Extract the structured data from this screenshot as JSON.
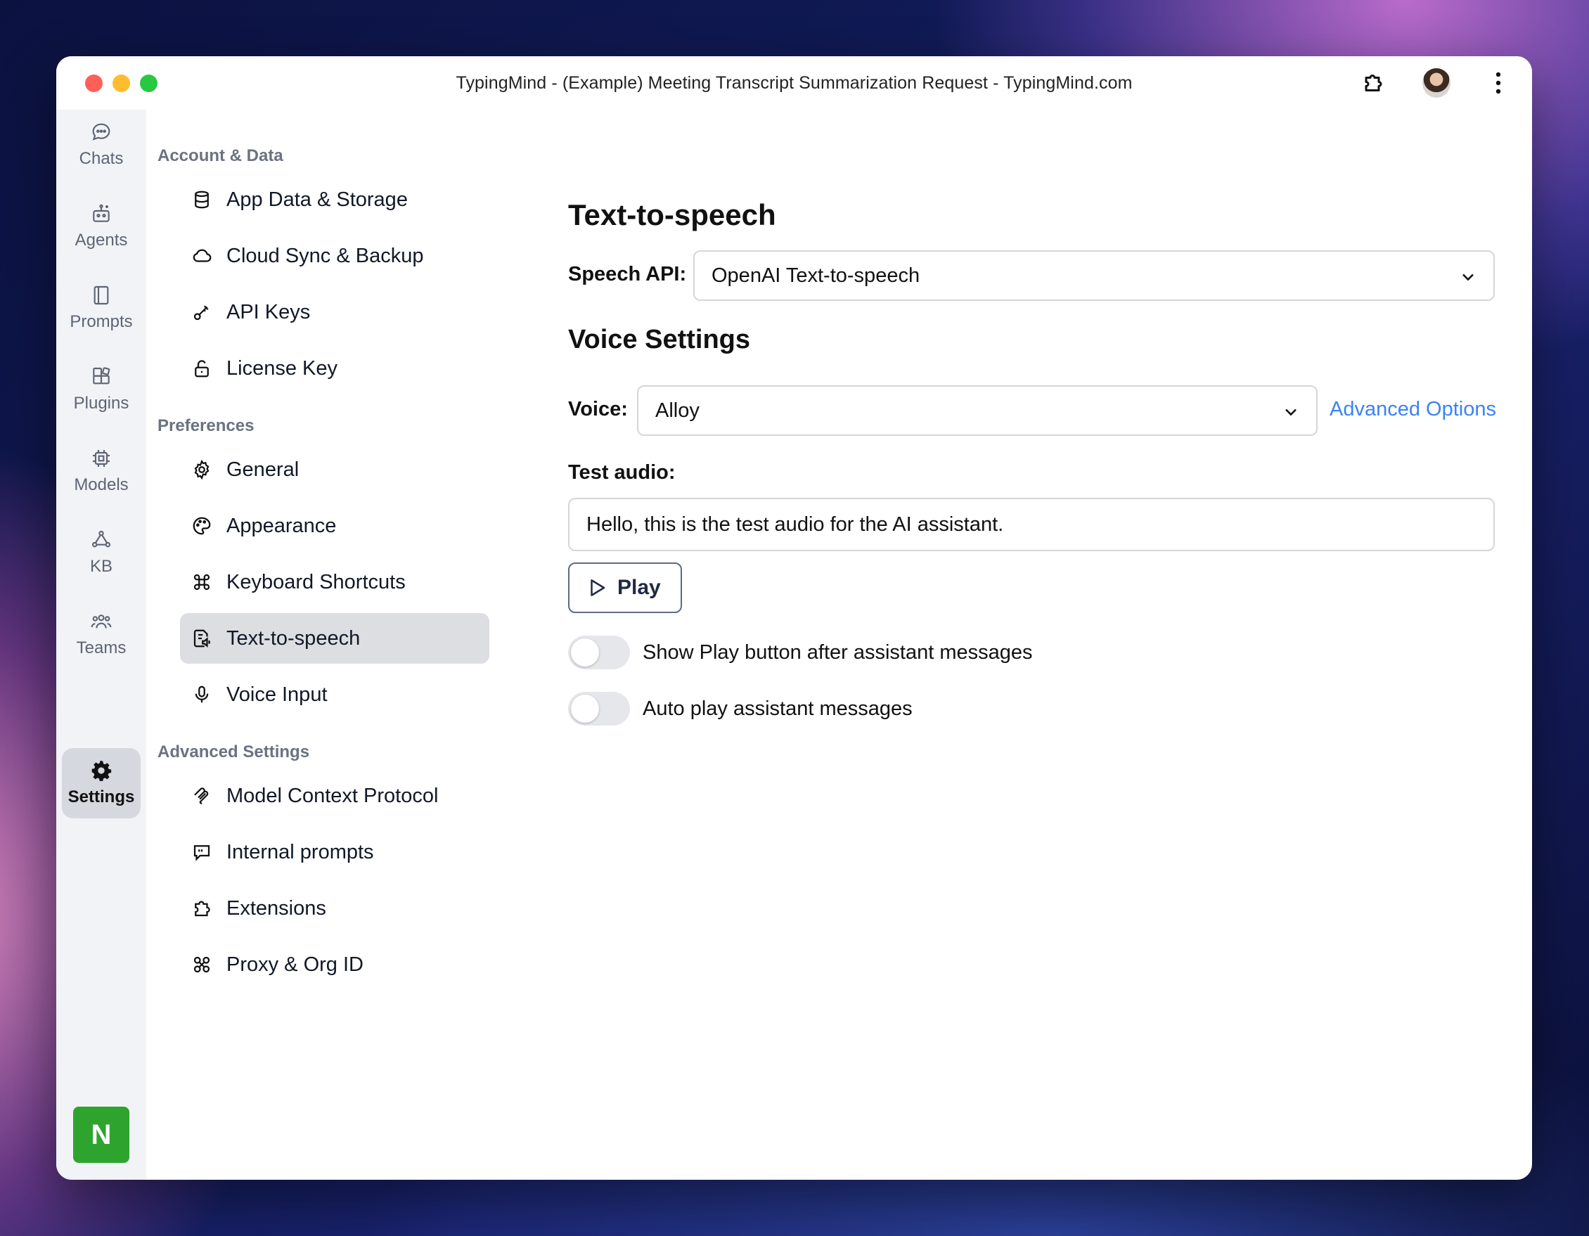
{
  "window": {
    "title": "TypingMind - (Example) Meeting Transcript Summarization Request - TypingMind.com"
  },
  "rail": {
    "items": [
      {
        "label": "Chats",
        "icon": "chat-bubble-icon"
      },
      {
        "label": "Agents",
        "icon": "agents-icon"
      },
      {
        "label": "Prompts",
        "icon": "book-icon"
      },
      {
        "label": "Plugins",
        "icon": "plugins-icon"
      },
      {
        "label": "Models",
        "icon": "chip-icon"
      },
      {
        "label": "KB",
        "icon": "knowledge-base-icon"
      },
      {
        "label": "Teams",
        "icon": "users-icon"
      },
      {
        "label": "Settings",
        "icon": "gear-icon",
        "active": true
      }
    ],
    "user_initial": "N",
    "user_color": "#2ea42f"
  },
  "menu": {
    "sections": [
      {
        "title": "Account & Data",
        "items": [
          "App Data & Storage",
          "Cloud Sync & Backup",
          "API Keys",
          "License Key"
        ]
      },
      {
        "title": "Preferences",
        "items": [
          "General",
          "Appearance",
          "Keyboard Shortcuts",
          "Text-to-speech",
          "Voice Input"
        ]
      },
      {
        "title": "Advanced Settings",
        "items": [
          "Model Context Protocol",
          "Internal prompts",
          "Extensions",
          "Proxy & Org ID"
        ]
      }
    ],
    "active_item": "Text-to-speech"
  },
  "content": {
    "title": "Text-to-speech",
    "speech_api_label": "Speech API:",
    "speech_api_value": "OpenAI Text-to-speech",
    "voice_settings_title": "Voice Settings",
    "voice_label": "Voice:",
    "voice_value": "Alloy",
    "advanced_options": "Advanced Options",
    "test_audio_label": "Test audio:",
    "test_audio_value": "Hello, this is the test audio for the AI assistant.",
    "play_label": "Play",
    "toggle_show_play": "Show Play button after assistant messages",
    "toggle_auto_play": "Auto play assistant messages"
  },
  "colors": {
    "accent_link": "#3b82f6",
    "active_bg": "#dddee1"
  }
}
